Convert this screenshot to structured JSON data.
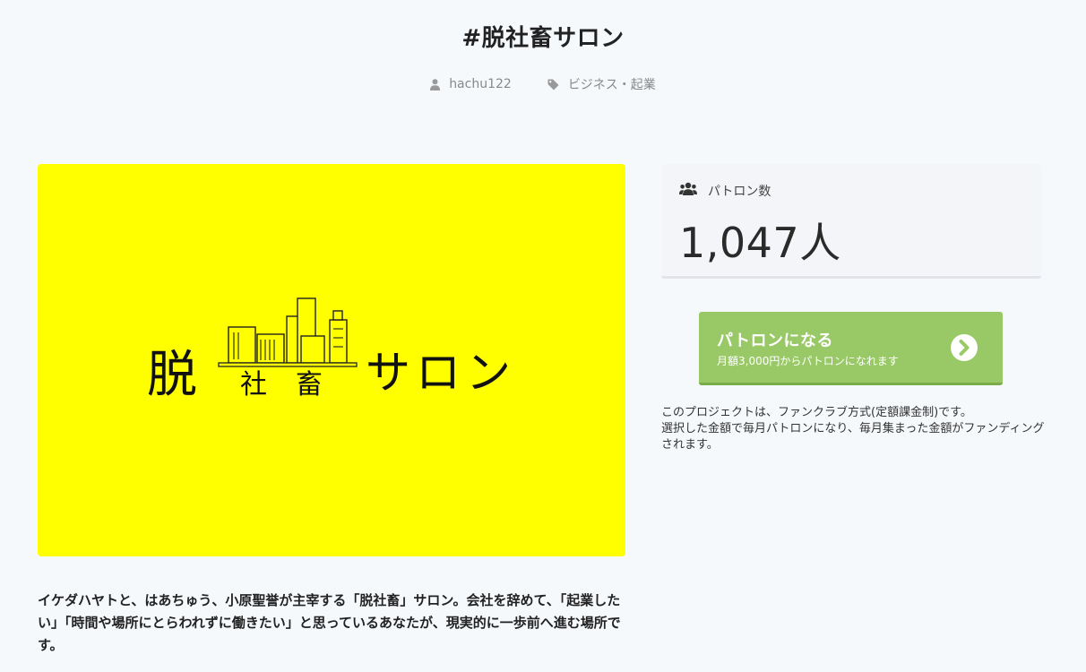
{
  "header": {
    "title": "#脱社畜サロン",
    "author": "hachu122",
    "category": "ビジネス・起業"
  },
  "hero": {
    "logo_char_left": "脱",
    "logo_char_mid1": "社",
    "logo_char_mid2": "畜",
    "logo_text_right": "サロン",
    "background_color": "#ffff00"
  },
  "description": "イケダハヤトと、はあちゅう、小原聖誉が主宰する「脱社畜」サロン。会社を辞めて、「起業したい」「時間や場所にとらわれずに働きたい」と思っているあなたが、現実的に一歩前へ進む場所です。",
  "patrons": {
    "label": "パトロン数",
    "count": "1,047人"
  },
  "cta": {
    "title": "パトロンになる",
    "subtitle": "月額3,000円からパトロンになれます",
    "color": "#99c966"
  },
  "note": {
    "line1": "このプロジェクトは、ファンクラブ方式(定額課金制)です。",
    "line2": "選択した金額で毎月パトロンになり、毎月集まった金額がファンディングされます。"
  },
  "icons": {
    "author": "user-icon",
    "category": "tag-icon",
    "patrons": "users-icon",
    "cta": "chevron-right-circle-icon"
  }
}
